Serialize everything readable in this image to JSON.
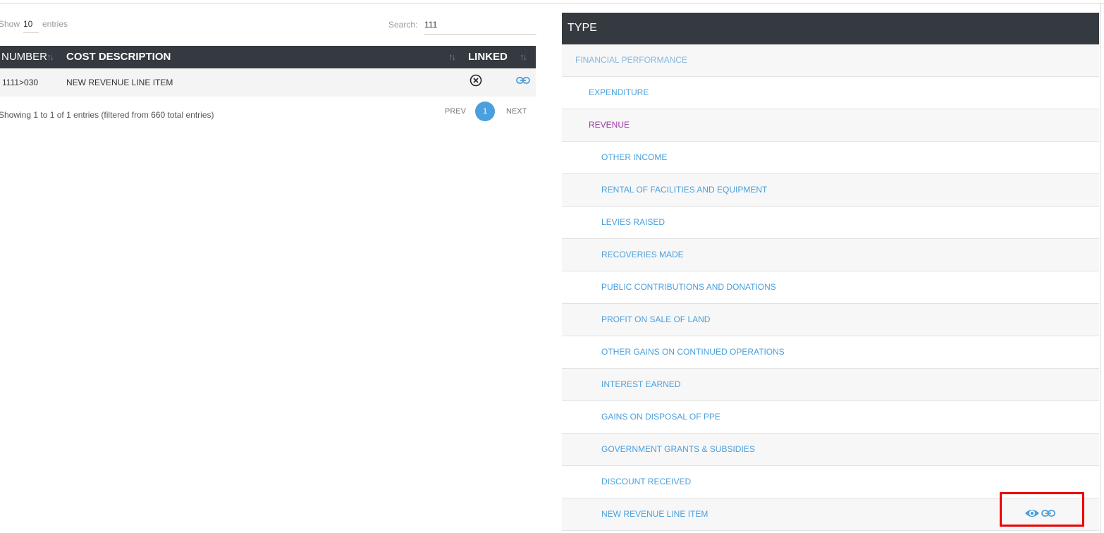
{
  "table_controls": {
    "show_label": "Show",
    "show_value": "10",
    "entries_label": "entries",
    "search_label": "Search:",
    "search_value": "111"
  },
  "table": {
    "columns": [
      "NUMBER",
      "COST DESCRIPTION",
      "LINKED"
    ],
    "sort_glyph": "↑↓",
    "rows": [
      {
        "number": "1111>030",
        "cost_description": "NEW REVENUE LINE ITEM",
        "linked_icon": "x-circle-icon",
        "action_icon": "link-icon"
      }
    ]
  },
  "pagination": {
    "info": "Showing 1 to 1 of 1 entries (filtered from 660 total entries)",
    "prev": "PREV",
    "current_page": "1",
    "next": "NEXT"
  },
  "type_tree": {
    "header": "TYPE",
    "items": [
      {
        "label": "FINANCIAL PERFORMANCE",
        "level": 0
      },
      {
        "label": "EXPENDITURE",
        "level": 1
      },
      {
        "label": "REVENUE",
        "level": 1,
        "active": true
      },
      {
        "label": "OTHER INCOME",
        "level": 2
      },
      {
        "label": "RENTAL OF FACILITIES AND EQUIPMENT",
        "level": 2
      },
      {
        "label": "LEVIES RAISED",
        "level": 2
      },
      {
        "label": "RECOVERIES MADE",
        "level": 2
      },
      {
        "label": "PUBLIC CONTRIBUTIONS AND DONATIONS",
        "level": 2
      },
      {
        "label": "PROFIT ON SALE OF LAND",
        "level": 2
      },
      {
        "label": "OTHER GAINS ON CONTINUED OPERATIONS",
        "level": 2
      },
      {
        "label": "INTEREST EARNED",
        "level": 2
      },
      {
        "label": "GAINS ON DISPOSAL OF PPE",
        "level": 2
      },
      {
        "label": "GOVERNMENT GRANTS & SUBSIDIES",
        "level": 2
      },
      {
        "label": "DISCOUNT RECEIVED",
        "level": 2
      },
      {
        "label": "NEW REVENUE LINE ITEM",
        "level": 2,
        "actions": [
          "eye-icon",
          "link-icon"
        ]
      }
    ]
  },
  "colors": {
    "header_bg": "#343a40",
    "link_blue": "#4a9fdc",
    "active_purple": "#9c3aa5",
    "highlight_red": "#ee0000"
  }
}
